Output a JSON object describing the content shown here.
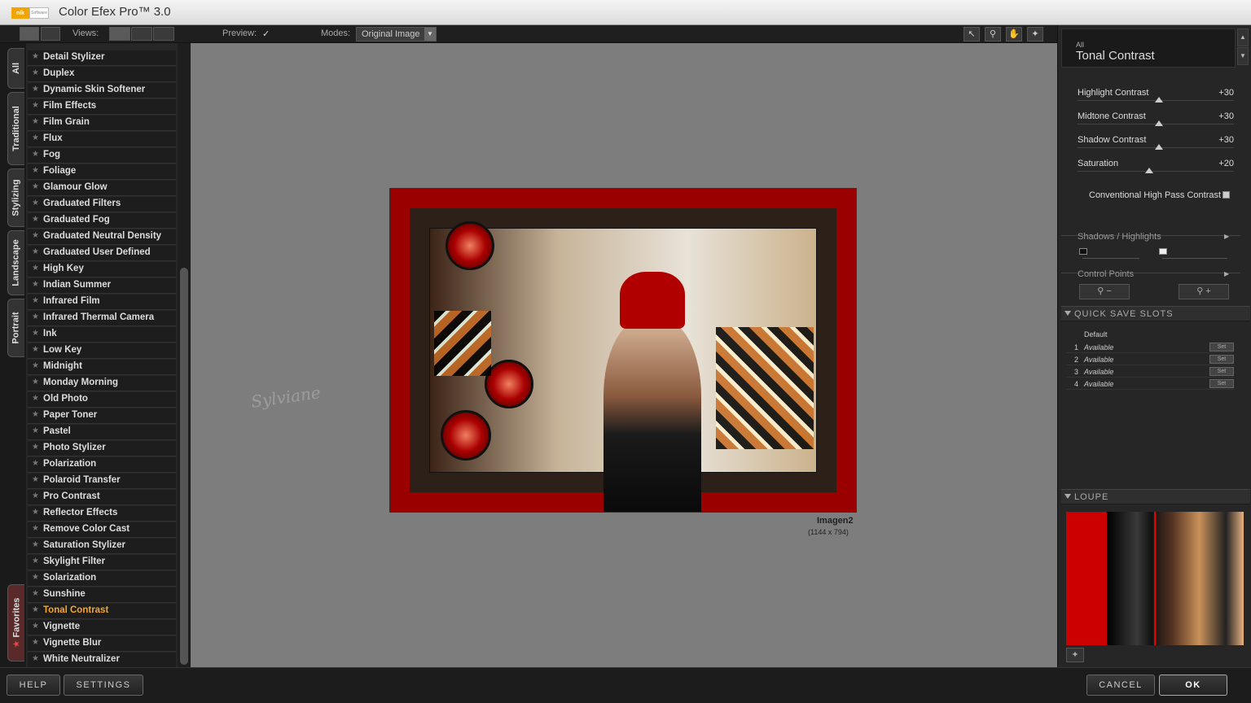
{
  "window": {
    "logo_left": "nik",
    "logo_right": "Software",
    "title": "Color Efex Pro™ 3.0"
  },
  "toolbar": {
    "views_label": "Views:",
    "preview_label": "Preview:",
    "preview_checked": "✓",
    "modes_label": "Modes:",
    "modes_value": "Original Image"
  },
  "tabs": [
    "All",
    "Traditional",
    "Stylizing",
    "Landscape",
    "Portrait"
  ],
  "favorites_tab": "Favorites",
  "filters": [
    "Detail Stylizer",
    "Duplex",
    "Dynamic Skin Softener",
    "Film Effects",
    "Film Grain",
    "Flux",
    "Fog",
    "Foliage",
    "Glamour Glow",
    "Graduated Filters",
    "Graduated Fog",
    "Graduated Neutral Density",
    "Graduated User Defined",
    "High Key",
    "Indian Summer",
    "Infrared Film",
    "Infrared Thermal Camera",
    "Ink",
    "Low Key",
    "Midnight",
    "Monday Morning",
    "Old Photo",
    "Paper Toner",
    "Pastel",
    "Photo Stylizer",
    "Polarization",
    "Polaroid Transfer",
    "Pro Contrast",
    "Reflector Effects",
    "Remove Color Cast",
    "Saturation Stylizer",
    "Skylight Filter",
    "Solarization",
    "Sunshine",
    "Tonal Contrast",
    "Vignette",
    "Vignette Blur",
    "White Neutralizer"
  ],
  "active_filter": "Tonal Contrast",
  "image": {
    "name": "Imagen2",
    "dims": "(1144 x 794)",
    "watermark": "Sylviane"
  },
  "panel": {
    "category": "All",
    "filter_name": "Tonal Contrast",
    "sliders": [
      {
        "name": "Highlight Contrast",
        "value": "+30",
        "level": 0.52
      },
      {
        "name": "Midtone Contrast",
        "value": "+30",
        "level": 0.52
      },
      {
        "name": "Shadow Contrast",
        "value": "+30",
        "level": 0.52
      },
      {
        "name": "Saturation",
        "value": "+20",
        "level": 0.46
      }
    ],
    "checkbox_label": "Conventional High Pass Contrast",
    "shadows_highlights": "Shadows / Highlights",
    "control_points": "Control Points"
  },
  "quick_save": {
    "title": "QUICK SAVE SLOTS",
    "default": "Default",
    "slots": [
      {
        "n": "1",
        "label": "Available",
        "btn": "Set"
      },
      {
        "n": "2",
        "label": "Available",
        "btn": "Set"
      },
      {
        "n": "3",
        "label": "Available",
        "btn": "Set"
      },
      {
        "n": "4",
        "label": "Available",
        "btn": "Set"
      }
    ]
  },
  "loupe": {
    "title": "LOUPE"
  },
  "buttons": {
    "help": "HELP",
    "settings": "SETTINGS",
    "cancel": "CANCEL",
    "ok": "OK"
  }
}
